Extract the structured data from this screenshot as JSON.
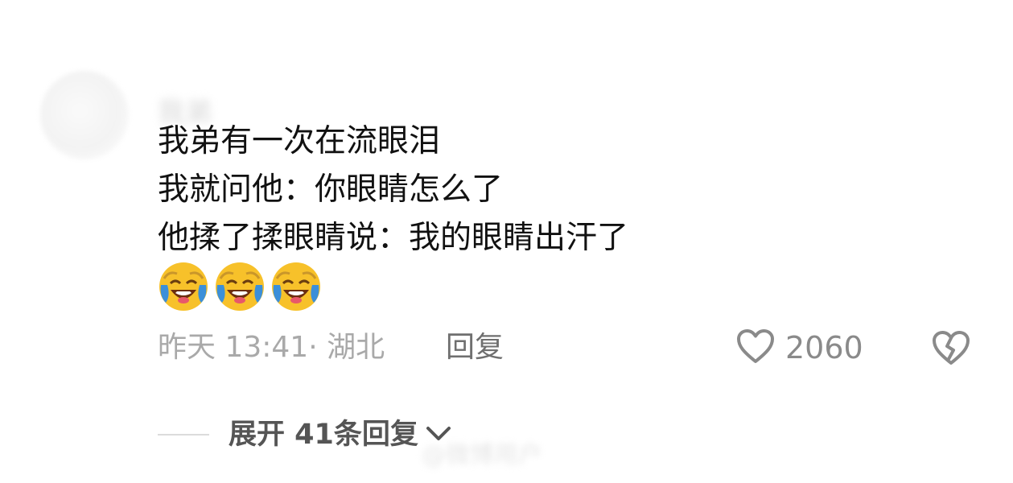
{
  "comment": {
    "author": "我弟",
    "lines": [
      "我弟有一次在流眼泪",
      "我就问他：你眼睛怎么了",
      "他揉了揉眼睛说：我的眼睛出汗了"
    ],
    "emojis": [
      "laughing-crying-emoji",
      "laughing-crying-emoji",
      "laughing-crying-emoji"
    ],
    "meta": {
      "time_location": "昨天 13:41· 湖北",
      "reply_label": "回复",
      "like_count": "2060"
    },
    "replies": {
      "expand_label": "展开 41条回复"
    }
  },
  "watermark": "@微博用户",
  "icons": {
    "like": "heart-outline-icon",
    "dislike": "broken-heart-icon",
    "expand": "chevron-down-icon"
  },
  "colors": {
    "text_primary": "#111111",
    "text_secondary": "#a9a9a9",
    "icon_gray": "#8a8a8a",
    "emoji_yellow": "#f7c12a",
    "emoji_tear": "#3b8fd9"
  }
}
